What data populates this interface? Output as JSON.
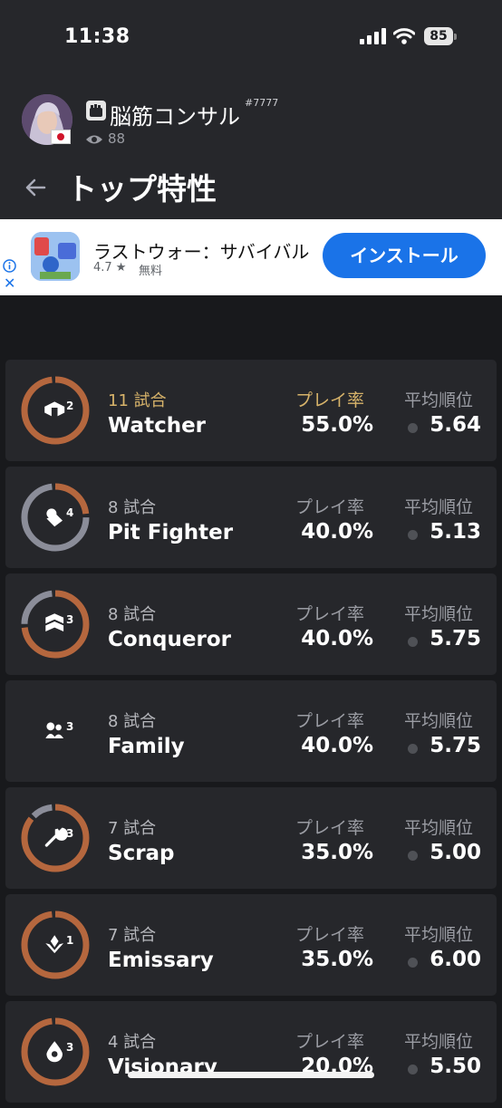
{
  "status": {
    "time": "11:38",
    "battery": "85"
  },
  "profile": {
    "name": "脳筋コンサル",
    "tag": "#7777",
    "views": "88"
  },
  "header": {
    "title": "トップ特性"
  },
  "ad": {
    "title": "ラストウォー：サバイバル",
    "rating": "4.7 ★",
    "price": "無料",
    "install_label": "インストール",
    "close": "✕"
  },
  "labels": {
    "play_rate": "プレイ率",
    "avg_place": "平均順位"
  },
  "traits": [
    {
      "games": "11 試合",
      "name": "Watcher",
      "play_rate": "55.0%",
      "avg_place": "5.64",
      "tier": "2",
      "ring_secondary_frac": 0,
      "icon": "watcher-icon",
      "highlight": true
    },
    {
      "games": "8 試合",
      "name": "Pit Fighter",
      "play_rate": "40.0%",
      "avg_place": "5.13",
      "tier": "4",
      "ring_secondary_frac": 0.75,
      "icon": "pit-fighter-icon",
      "highlight": false
    },
    {
      "games": "8 試合",
      "name": "Conqueror",
      "play_rate": "40.0%",
      "avg_place": "5.75",
      "tier": "3",
      "ring_secondary_frac": 0.25,
      "icon": "conqueror-icon",
      "highlight": false
    },
    {
      "games": "8 試合",
      "name": "Family",
      "play_rate": "40.0%",
      "avg_place": "5.75",
      "tier": "3",
      "ring_secondary_frac": null,
      "icon": "family-icon",
      "highlight": false
    },
    {
      "games": "7 試合",
      "name": "Scrap",
      "play_rate": "35.0%",
      "avg_place": "5.00",
      "tier": "3",
      "ring_secondary_frac": 0.125,
      "icon": "scrap-icon",
      "highlight": false
    },
    {
      "games": "7 試合",
      "name": "Emissary",
      "play_rate": "35.0%",
      "avg_place": "6.00",
      "tier": "1",
      "ring_secondary_frac": 0,
      "icon": "emissary-icon",
      "highlight": false
    },
    {
      "games": "4 試合",
      "name": "Visionary",
      "play_rate": "20.0%",
      "avg_place": "5.50",
      "tier": "3",
      "ring_secondary_frac": 0,
      "icon": "visionary-icon",
      "highlight": false
    }
  ],
  "colors": {
    "ring_primary": "#b5673e",
    "ring_secondary": "#8b8d99",
    "gold": "#d7b36a",
    "install": "#1a73e8"
  }
}
